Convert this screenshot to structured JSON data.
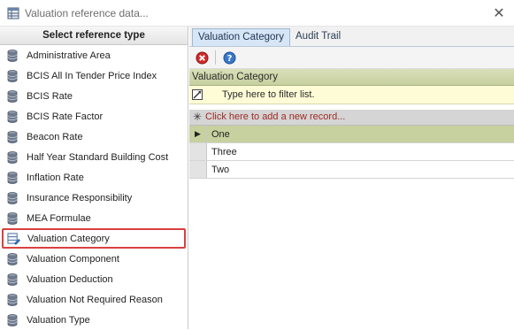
{
  "window": {
    "title": "Valuation reference data...",
    "close_glyph": "✕"
  },
  "left_panel": {
    "header": "Select reference type",
    "items": [
      {
        "label": "Administrative Area",
        "icon": "database-icon"
      },
      {
        "label": "BCIS All In Tender Price Index",
        "icon": "database-icon"
      },
      {
        "label": "BCIS Rate",
        "icon": "database-icon"
      },
      {
        "label": "BCIS Rate Factor",
        "icon": "database-icon"
      },
      {
        "label": "Beacon Rate",
        "icon": "database-icon"
      },
      {
        "label": "Half Year Standard Building Cost",
        "icon": "database-icon"
      },
      {
        "label": "Inflation Rate",
        "icon": "database-icon"
      },
      {
        "label": "Insurance Responsibility",
        "icon": "database-icon"
      },
      {
        "label": "MEA Formulae",
        "icon": "database-icon"
      },
      {
        "label": "Valuation Category",
        "icon": "database-edit-icon",
        "selected": true
      },
      {
        "label": "Valuation Component",
        "icon": "database-icon"
      },
      {
        "label": "Valuation Deduction",
        "icon": "database-icon"
      },
      {
        "label": "Valuation Not Required Reason",
        "icon": "database-icon"
      },
      {
        "label": "Valuation Type",
        "icon": "database-icon"
      }
    ]
  },
  "tabs": [
    {
      "label": "Valuation Category",
      "active": true
    },
    {
      "label": "Audit Trail",
      "active": false
    }
  ],
  "toolbar": {
    "delete_icon": "delete-icon",
    "help_icon": "help-icon"
  },
  "grid": {
    "caption": "Valuation Category",
    "filter_placeholder": "Type here to filter list.",
    "new_record_star": "✳",
    "new_record_text": "Click here to add a new record...",
    "current_marker": "▶",
    "rows": [
      {
        "value": "One",
        "current": true
      },
      {
        "value": "Three",
        "current": false
      },
      {
        "value": "Two",
        "current": false
      }
    ]
  },
  "colors": {
    "selection_outline": "#d9413f",
    "grid_header": "#c7d09f",
    "filter_row": "#fdfcd6",
    "tab_active": "#d7e6f6",
    "new_record_text": "#9d2a23"
  }
}
